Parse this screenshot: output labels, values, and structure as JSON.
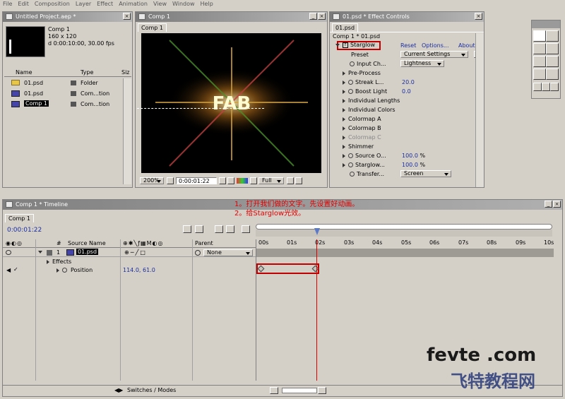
{
  "menu": [
    "File",
    "Edit",
    "Composition",
    "Layer",
    "Effect",
    "Animation",
    "View",
    "Window",
    "Help"
  ],
  "project": {
    "title": "Untitled Project.aep *",
    "comp_name": "Comp 1",
    "comp_size": "160 x 120",
    "comp_duration": "d 0:00:10:00, 30.00 fps",
    "col_name": "Name",
    "col_type": "Type",
    "col_size": "Siz",
    "items": [
      {
        "name": "01.psd",
        "type": "Folder"
      },
      {
        "name": "01.psd",
        "type": "Com...tion"
      },
      {
        "name": "Comp 1",
        "type": "Com...tion"
      }
    ]
  },
  "comp": {
    "title": "Comp 1",
    "tab": "Comp 1",
    "viewer_text": "FAB",
    "zoom": "200%",
    "timecode": "0:00:01:22",
    "quality": "Full"
  },
  "effects": {
    "title": "01.psd * Effect Controls",
    "tab": "01.psd",
    "breadcrumb": "Comp 1 * 01.psd",
    "effect_name": "Starglow",
    "reset": "Reset",
    "options": "Options...",
    "about": "About",
    "preset_label": "Preset",
    "preset_value": "Current Settings",
    "input_label": "Input Ch...",
    "input_value": "Lightness",
    "preprocess": "Pre-Process",
    "streak_label": "Streak L...",
    "streak_value": "20.0",
    "boost_label": "Boost Light",
    "boost_value": "0.0",
    "ind_lengths": "Individual Lengths",
    "ind_colors": "Individual Colors",
    "colormap_a": "Colormap A",
    "colormap_b": "Colormap B",
    "colormap_c": "Colormap C",
    "shimmer": "Shimmer",
    "source_label": "Source O...",
    "source_value": "100.0",
    "source_unit": "%",
    "starglow_label": "Starglow...",
    "starglow_value": "100.0",
    "starglow_unit": "%",
    "transfer_label": "Transfer...",
    "transfer_value": "Screen"
  },
  "timeline": {
    "title": "Comp 1 * Timeline",
    "tab": "Comp 1",
    "timecode": "0:00:01:22",
    "annotation1": "1。打开我们做的文字。先设置好动画。",
    "annotation2": "2。给Starglow光效。",
    "col_num": "#",
    "col_source": "Source Name",
    "col_parent": "Parent",
    "layer_num": "1",
    "layer_name": "01.psd",
    "parent_value": "None",
    "effects_label": "Effects",
    "position_label": "Position",
    "position_value": "114.0, 61.0",
    "switches_modes": "Switches / Modes",
    "ruler": [
      "00s",
      "01s",
      "02s",
      "03s",
      "04s",
      "05s",
      "06s",
      "07s",
      "08s",
      "09s",
      "10s"
    ]
  },
  "watermark": {
    "line1": "fevte .com",
    "line2": "飞特教程网"
  },
  "colors": {
    "annotation": "#e00000",
    "highlight_box": "#c00000",
    "link_blue": "#1a2ea0",
    "title_gray": "#8a8a8a"
  }
}
